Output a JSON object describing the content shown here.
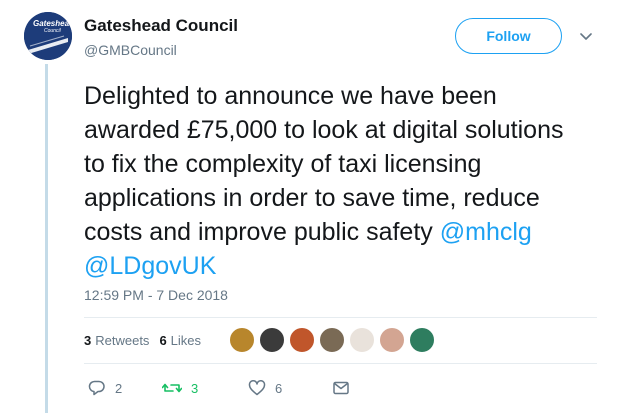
{
  "author": {
    "name": "Gateshead Council",
    "handle": "@GMBCouncil",
    "avatar_text": "Gateshead",
    "avatar_subtext": "Council"
  },
  "follow_label": "Follow",
  "tweet": {
    "text": "Delighted to announce we have been awarded £75,000 to look at digital solutions to fix the complexity of taxi licensing applications in order to save time, reduce costs and improve public safety ",
    "mentions": [
      "@mhclg",
      "@LDgovUK"
    ],
    "timestamp": "12:59 PM - 7 Dec 2018"
  },
  "stats": {
    "retweets_count": "3",
    "retweets_label": "Retweets",
    "likes_count": "6",
    "likes_label": "Likes"
  },
  "likers": [
    {
      "color": "#b8862c"
    },
    {
      "color": "#3b3b3b"
    },
    {
      "color": "#c0562b"
    },
    {
      "color": "#7a6a55"
    },
    {
      "color": "#e9e2db"
    },
    {
      "color": "#d3a592"
    },
    {
      "color": "#2e7d5f"
    }
  ],
  "actions": {
    "reply_count": "2",
    "retweet_count": "3",
    "like_count": "6"
  },
  "colors": {
    "accent": "#1da1f2",
    "retweet_green": "#17bf63",
    "muted": "#657786",
    "thread_line": "#c4dbe8"
  }
}
